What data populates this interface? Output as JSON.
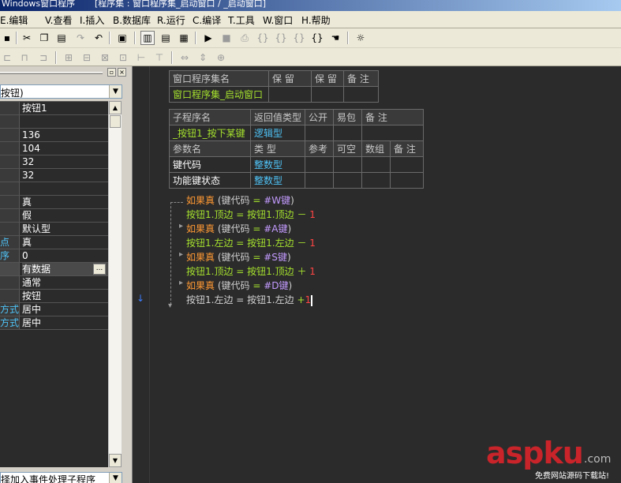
{
  "title": {
    "left": "Windows窗口程序",
    "right": "[程序集 : 窗口程序集_启动窗口 / _启动窗口]"
  },
  "menu": [
    "E.编辑",
    "V.查看",
    "I.插入",
    "B.数据库",
    "R.运行",
    "C.编译",
    "T.工具",
    "W.窗口",
    "H.帮助"
  ],
  "toolbar": {
    "icons": [
      "save-icon",
      "cut-icon",
      "copy-icon",
      "paste-icon",
      "redo-icon",
      "undo-icon",
      "find-icon",
      "layout1-icon",
      "layout2-icon",
      "layout3-icon",
      "run-icon",
      "stop-icon",
      "step1-icon",
      "step2-icon",
      "step3-icon",
      "step4-icon",
      "step5-icon",
      "hand-icon",
      "debug-icon"
    ]
  },
  "left_panel": {
    "combo_value": "按钮)",
    "properties": [
      {
        "name": "",
        "value": "按钮1"
      },
      {
        "name": "",
        "value": ""
      },
      {
        "name": "",
        "value": "136"
      },
      {
        "name": "",
        "value": "104"
      },
      {
        "name": "",
        "value": "32"
      },
      {
        "name": "",
        "value": "32"
      },
      {
        "name": "",
        "value": ""
      },
      {
        "name": "",
        "value": "真"
      },
      {
        "name": "",
        "value": "假"
      },
      {
        "name": "",
        "value": "默认型"
      },
      {
        "name": "点",
        "value": "真"
      },
      {
        "name": "序",
        "value": "0"
      },
      {
        "name": "",
        "value": "有数据"
      },
      {
        "name": "",
        "value": "通常"
      },
      {
        "name": "",
        "value": "按钮"
      },
      {
        "name": "方式",
        "value": "居中"
      },
      {
        "name": "方式",
        "value": "居中"
      }
    ],
    "ellipsis_label": "...",
    "bottom_combo": "择加入事件处理子程序"
  },
  "assembly_table": {
    "headers": [
      "窗口程序集名",
      "保 留",
      "保 留",
      "备 注"
    ],
    "row": [
      "窗口程序集_启动窗口",
      "",
      "",
      ""
    ]
  },
  "sub_table": {
    "headers": [
      "子程序名",
      "返回值类型",
      "公开",
      "易包",
      "备 注"
    ],
    "row": [
      "_按钮1_按下某键",
      "逻辑型",
      "",
      "",
      ""
    ],
    "param_headers": [
      "参数名",
      "类 型",
      "参考",
      "可空",
      "数组",
      "备 注"
    ],
    "params": [
      [
        "键代码",
        "整数型",
        "",
        "",
        "",
        ""
      ],
      [
        "功能键状态",
        "整数型",
        "",
        "",
        "",
        ""
      ]
    ]
  },
  "code": {
    "if_kw": "如果真",
    "lines": [
      {
        "type": "if",
        "cond_var": "(键代码",
        "eq": "=",
        "const": "#W键",
        "close": ")"
      },
      {
        "type": "assign",
        "lhs": "按钮1.顶边",
        "eq": "=",
        "rhs": "按钮1.顶边",
        "op": "－",
        "num": "1"
      },
      {
        "type": "if",
        "cond_var": "(键代码",
        "eq": "=",
        "const": "#A键",
        "close": ")"
      },
      {
        "type": "assign",
        "lhs": "按钮1.左边",
        "eq": "=",
        "rhs": "按钮1.左边",
        "op": "－",
        "num": "1"
      },
      {
        "type": "if",
        "cond_var": "(键代码",
        "eq": "=",
        "const": "#S键",
        "close": ")"
      },
      {
        "type": "assign",
        "lhs": "按钮1.顶边",
        "eq": "=",
        "rhs": "按钮1.顶边",
        "op": "＋",
        "num": "1"
      },
      {
        "type": "if",
        "cond_var": "(键代码",
        "eq": "=",
        "const": "#D键",
        "close": ")"
      },
      {
        "type": "assign_edit",
        "lhs": "按钮1.左边",
        "eq": "=",
        "rhs": "按钮1.左边",
        "op": "+",
        "num": "1"
      }
    ]
  },
  "watermark": {
    "logo": "aspku",
    "suffix": ".com",
    "subtitle": "免费网站源码下载站!"
  },
  "colors": {
    "editor_bg": "#2b2b2b",
    "keyword": "#ff9933",
    "variable": "#a6e22e",
    "constant": "#c39bff",
    "number": "#ff4444",
    "brand_red": "#c8242a"
  }
}
